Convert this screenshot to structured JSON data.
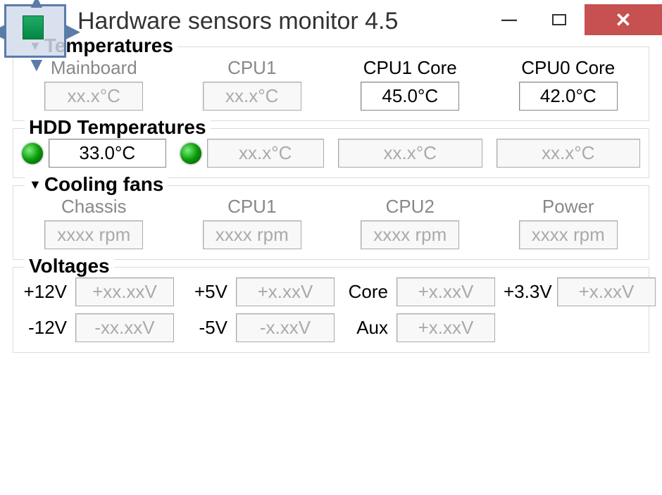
{
  "window": {
    "title": "Hardware sensors monitor 4.5",
    "minimize": "—",
    "close": "✕"
  },
  "sections": {
    "temperatures": {
      "title": "Temperatures",
      "items": [
        {
          "label": "Mainboard",
          "value": "xx.x°C",
          "active": false
        },
        {
          "label": "CPU1",
          "value": "xx.x°C",
          "active": false
        },
        {
          "label": "CPU1 Core",
          "value": "45.0°C",
          "active": true
        },
        {
          "label": "CPU0 Core",
          "value": "42.0°C",
          "active": true
        }
      ]
    },
    "hdd": {
      "title": "HDD Temperatures",
      "items": [
        {
          "value": "33.0°C",
          "active": true,
          "led": true
        },
        {
          "value": "xx.x°C",
          "active": false,
          "led": true
        },
        {
          "value": "xx.x°C",
          "active": false,
          "led": false
        },
        {
          "value": "xx.x°C",
          "active": false,
          "led": false
        }
      ]
    },
    "fans": {
      "title": "Cooling fans",
      "items": [
        {
          "label": "Chassis",
          "value": "xxxx rpm",
          "active": false
        },
        {
          "label": "CPU1",
          "value": "xxxx rpm",
          "active": false
        },
        {
          "label": "CPU2",
          "value": "xxxx rpm",
          "active": false
        },
        {
          "label": "Power",
          "value": "xxxx rpm",
          "active": false
        }
      ]
    },
    "voltages": {
      "title": "Voltages",
      "rows": [
        [
          {
            "label": "+12V",
            "value": "+xx.xxV"
          },
          {
            "label": "+5V",
            "value": "+x.xxV"
          },
          {
            "label": "Core",
            "value": "+x.xxV"
          },
          {
            "label": "+3.3V",
            "value": "+x.xxV"
          }
        ],
        [
          {
            "label": "-12V",
            "value": "-xx.xxV"
          },
          {
            "label": "-5V",
            "value": "-x.xxV"
          },
          {
            "label": "Aux",
            "value": "+x.xxV"
          },
          {
            "label": "",
            "value": ""
          }
        ]
      ]
    }
  }
}
